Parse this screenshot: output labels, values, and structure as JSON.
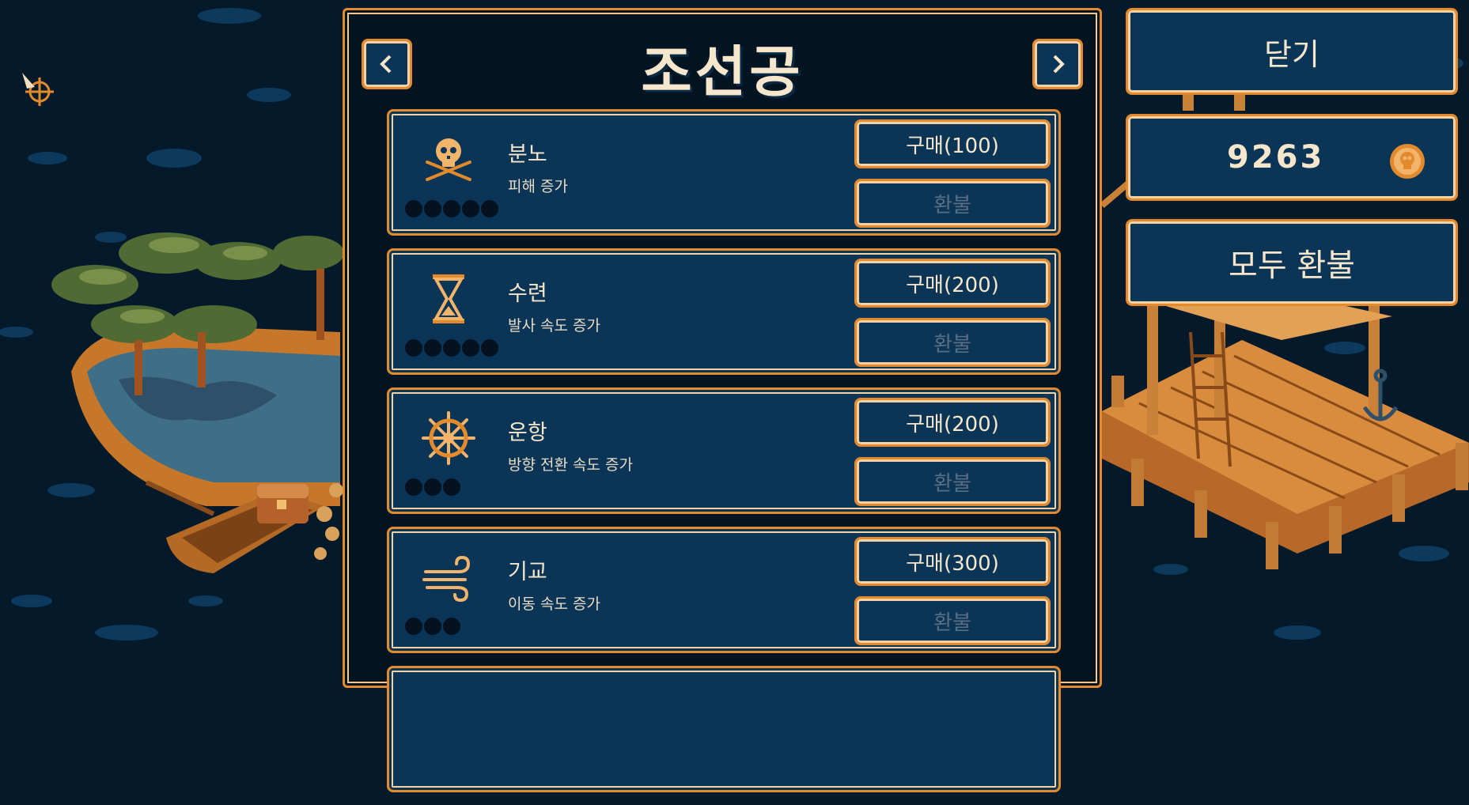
{
  "panel": {
    "title": "조선공",
    "prev_icon": "chevron-left-icon",
    "next_icon": "chevron-right-icon"
  },
  "upgrades": [
    {
      "name": "분노",
      "description": "피해 증가",
      "icon": "skull-crossbones-icon",
      "buy_label": "구매(100)",
      "refund_label": "환불",
      "level_pips": 5
    },
    {
      "name": "수련",
      "description": "발사 속도 증가",
      "icon": "hourglass-icon",
      "buy_label": "구매(200)",
      "refund_label": "환불",
      "level_pips": 5
    },
    {
      "name": "운항",
      "description": "방향 전환 속도 증가",
      "icon": "ship-wheel-icon",
      "buy_label": "구매(200)",
      "refund_label": "환불",
      "level_pips": 3
    },
    {
      "name": "기교",
      "description": "이동 속도 증가",
      "icon": "wind-icon",
      "buy_label": "구매(300)",
      "refund_label": "환불",
      "level_pips": 3
    }
  ],
  "side": {
    "close_label": "닫기",
    "coins": "9263",
    "coin_icon": "skull-coin-icon",
    "refund_all_label": "모두 환불"
  },
  "colors": {
    "accent_orange": "#e38a2c",
    "panel_blue": "#0b3556",
    "background": "#04192a",
    "text_cream": "#f6e6cc",
    "disabled_text": "#5a6f81"
  }
}
